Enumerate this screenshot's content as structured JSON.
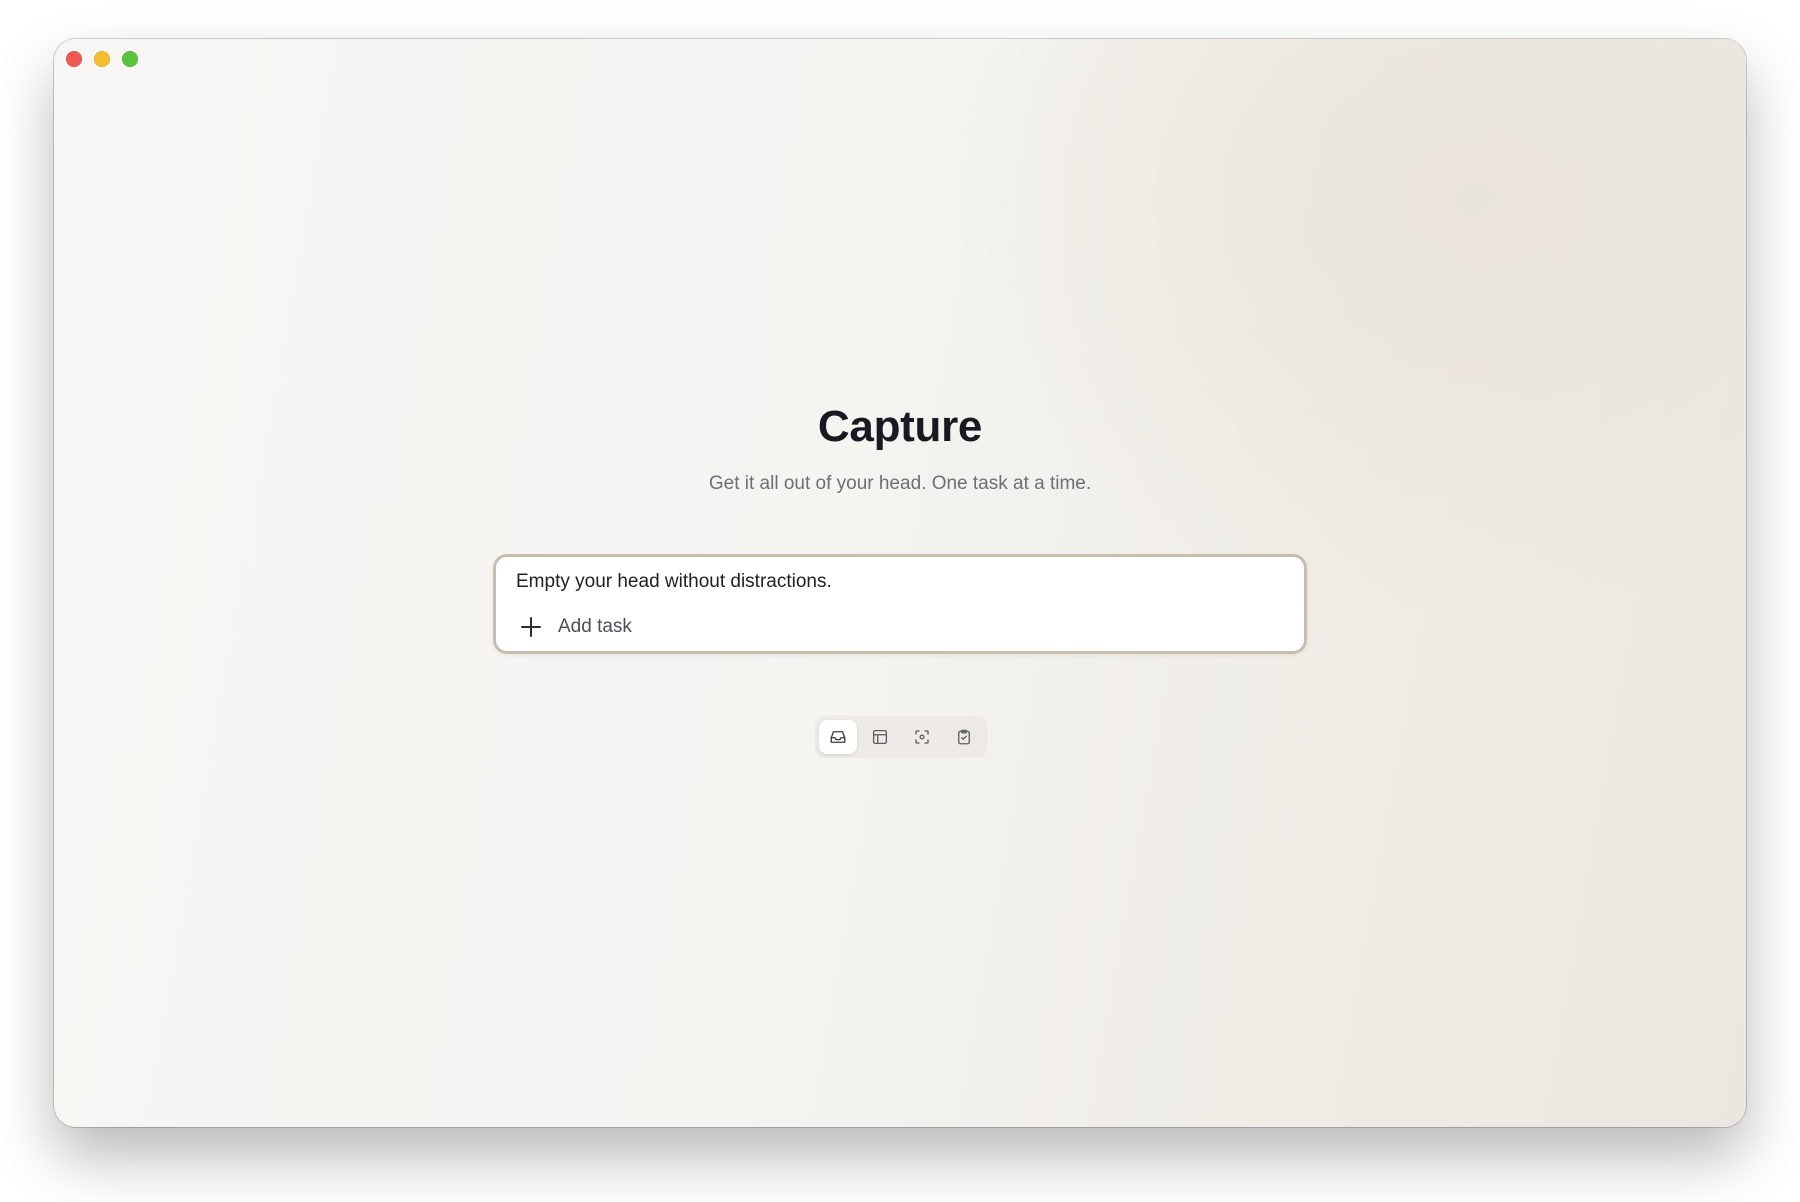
{
  "window": {
    "controls": [
      {
        "name": "close",
        "color": "#ee5a52"
      },
      {
        "name": "minimize",
        "color": "#f5bd2f"
      },
      {
        "name": "maximize",
        "color": "#5ac43f"
      }
    ]
  },
  "header": {
    "title": "Capture",
    "subtitle": "Get it all out of your head. One task at a time."
  },
  "card": {
    "text": "Empty your head without distractions.",
    "add_task_label": "Add task",
    "add_task_icon": "plus-icon"
  },
  "toolbar": {
    "items": [
      {
        "icon": "inbox-icon",
        "active": true
      },
      {
        "icon": "layout-icon",
        "active": false
      },
      {
        "icon": "focus-icon",
        "active": false
      },
      {
        "icon": "clipboard-check-icon",
        "active": false
      }
    ]
  },
  "colors": {
    "title": "#171a20",
    "subtitle": "#6b6f76",
    "card_border": "#c7bfae",
    "background": "#f5f4f1"
  }
}
